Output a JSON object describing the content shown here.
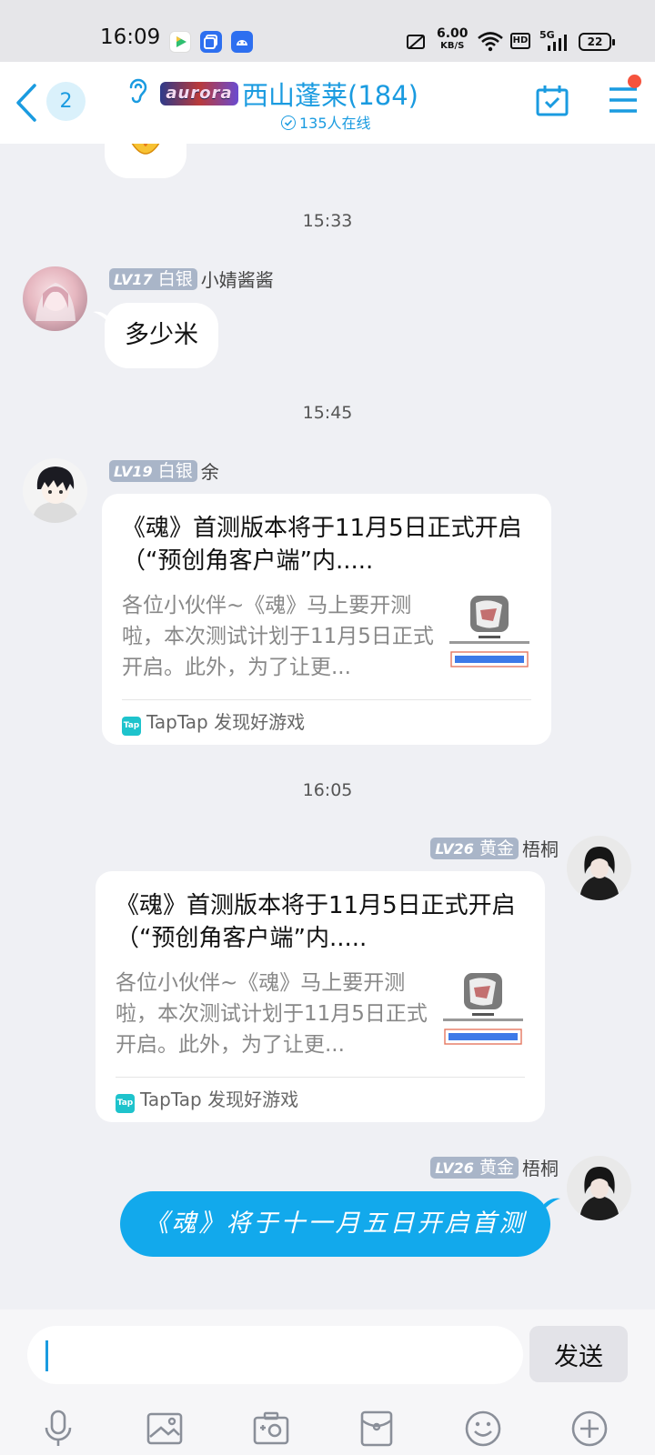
{
  "status_bar": {
    "time": "16:09",
    "net_speed": "6.00",
    "net_speed_unit": "KB/S",
    "hd": "HD",
    "network": "5G",
    "battery": "22"
  },
  "header": {
    "unread_count": "2",
    "group_logo_text": "aurora",
    "group_title": "西山蓬莱(184)",
    "online_status": "135人在线"
  },
  "chat": {
    "messages": [
      {
        "time": "15:33"
      },
      {
        "level": "LV17",
        "rank": "白银",
        "sender": "小婧酱酱",
        "text": "多少米"
      },
      {
        "time": "15:45"
      },
      {
        "level": "LV19",
        "rank": "白银",
        "sender": "余",
        "card": {
          "title": "《魂》首测版本将于11月5日正式开启（“预创角客户端”内.....",
          "desc": "各位小伙伴~《魂》马上要开测啦，本次测试计划于11月5日正式开启。此外，为了让更...",
          "source": "TapTap 发现好游戏"
        }
      },
      {
        "time": "16:05"
      },
      {
        "level": "LV26",
        "rank": "黄金",
        "sender": "梧桐",
        "card": {
          "title": "《魂》首测版本将于11月5日正式开启（“预创角客户端”内.....",
          "desc": "各位小伙伴~《魂》马上要开测啦，本次测试计划于11月5日正式开启。此外，为了让更...",
          "source": "TapTap 发现好游戏"
        }
      },
      {
        "level": "LV26",
        "rank": "黄金",
        "sender": "梧桐",
        "text": "《魂》将于十一月五日开启首测"
      }
    ]
  },
  "input_bar": {
    "placeholder": "",
    "send_label": "发送",
    "tools": [
      "microphone-icon",
      "image-icon",
      "camera-icon",
      "red-packet-icon",
      "emoji-icon",
      "plus-icon"
    ]
  },
  "colors": {
    "accent": "#1a9be0",
    "bubble_blue": "#12a9ec",
    "background": "#eff0f4",
    "badge_grey": "#a9b5c8",
    "notification": "#f5533d"
  }
}
